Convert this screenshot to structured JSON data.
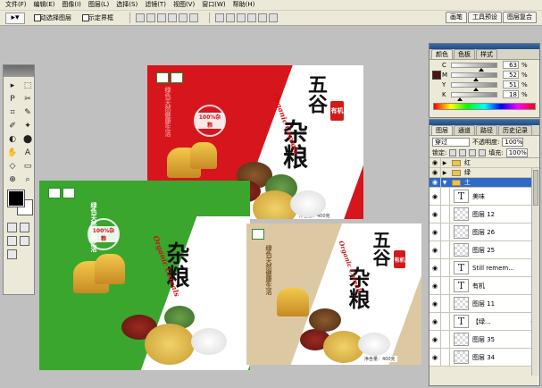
{
  "menu": {
    "items": [
      "文件(F)",
      "编辑(E)",
      "图像(I)",
      "图层(L)",
      "选择(S)",
      "滤镜(T)",
      "视图(V)",
      "窗口(W)",
      "帮助(H)"
    ]
  },
  "options": {
    "tool_icon": "move-arrow",
    "auto_select_label": "自动选择图层",
    "show_bounds_label": "显示定界框",
    "tabs": [
      "画笔",
      "工具预设",
      "图层复合"
    ]
  },
  "toolbox": {
    "foreground_color": "#000000",
    "background_color": "#ffffff",
    "tools": [
      "▸",
      "⬚",
      "P",
      "✂",
      "⌗",
      "✎",
      "✐",
      "✦",
      "◐",
      "⬤",
      "✋",
      "A",
      "◇",
      "▭",
      "⊕",
      "⌕"
    ]
  },
  "artwork": {
    "title_chars": "五谷",
    "big_char": "杂粮",
    "seal_text": "有机",
    "english": "Organic Cereals",
    "badge_text": "100%杂粮",
    "net_weight": "净含量：400克",
    "slogan": "绿色天然健康生活",
    "colors": {
      "red_box": "#d7151c",
      "green_box": "#3aa62e",
      "tan_box": "#dcc9a4"
    }
  },
  "color_panel": {
    "tabs": [
      "颜色",
      "色板",
      "样式"
    ],
    "rows": [
      {
        "label": "C",
        "value": "63",
        "unit": "%",
        "pos": 0.63
      },
      {
        "label": "M",
        "value": "52",
        "unit": "%",
        "pos": 0.52
      },
      {
        "label": "Y",
        "value": "51",
        "unit": "%",
        "pos": 0.51
      },
      {
        "label": "K",
        "value": "18",
        "unit": "%",
        "pos": 0.18
      }
    ]
  },
  "layers_panel": {
    "tabs": [
      "图层",
      "通道",
      "路径",
      "历史记录"
    ],
    "blend_mode": "穿过",
    "opacity_label": "不透明度:",
    "opacity_value": "100%",
    "lock_label": "锁定:",
    "fill_label": "填充:",
    "fill_value": "100%",
    "layers": [
      {
        "name": "红",
        "kind": "group",
        "open": false
      },
      {
        "name": "绿",
        "kind": "group",
        "open": false
      },
      {
        "name": "土",
        "kind": "group",
        "open": true,
        "selected": true
      },
      {
        "name": "美味",
        "kind": "text"
      },
      {
        "name": "图层 12",
        "kind": "pixel"
      },
      {
        "name": "图层 26",
        "kind": "pixel"
      },
      {
        "name": "图层 25",
        "kind": "pixel"
      },
      {
        "name": "Still remem...",
        "kind": "text"
      },
      {
        "name": "有机",
        "kind": "text"
      },
      {
        "name": "图层 11",
        "kind": "pixel"
      },
      {
        "name": "【绿...",
        "kind": "text",
        "fx": "⊘"
      },
      {
        "name": "图层 35",
        "kind": "pixel"
      },
      {
        "name": "图层 34",
        "kind": "pixel"
      }
    ]
  }
}
